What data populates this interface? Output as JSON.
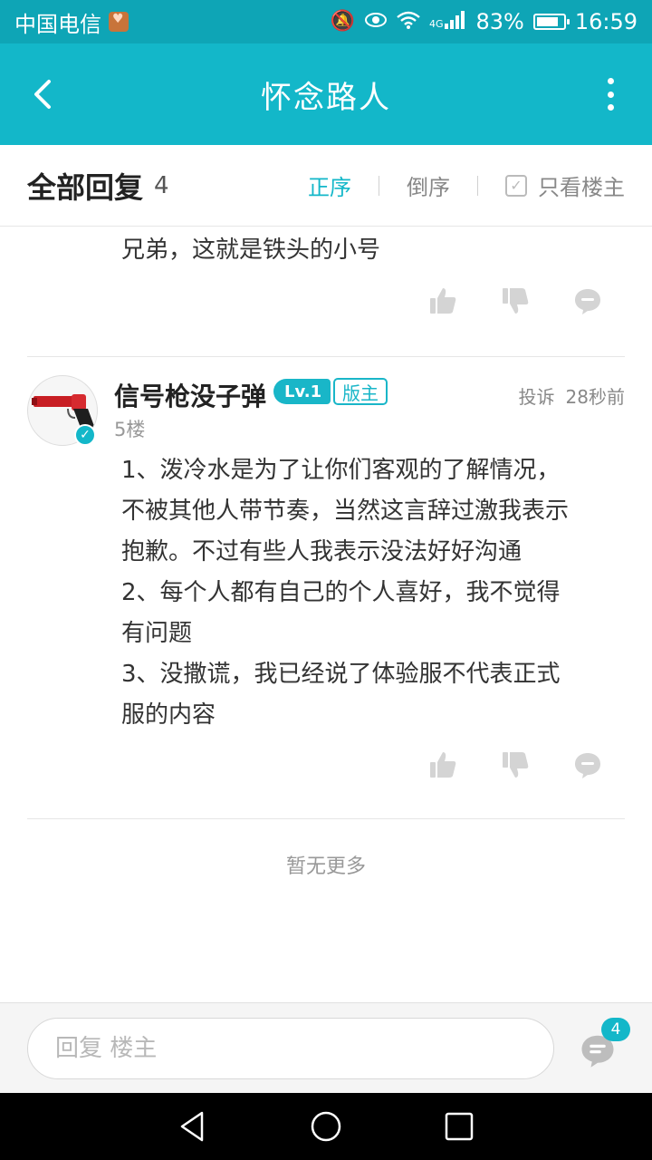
{
  "status_bar": {
    "carrier": "中国电信",
    "network": "4G",
    "battery": "83%",
    "battery_level": 0.83,
    "time": "16:59"
  },
  "app_bar": {
    "title": "怀念路人"
  },
  "sort_header": {
    "all_label": "全部回复",
    "count": "4",
    "order_asc": "正序",
    "order_desc": "倒序",
    "only_owner": "只看楼主"
  },
  "posts": [
    {
      "lines": [
        "兄弟，这就是铁头的小号"
      ]
    },
    {
      "author": "信号枪没子弹",
      "level": "Lv.1",
      "role": "版主",
      "floor": "5楼",
      "report": "投诉",
      "time": "28秒前",
      "lines": [
        "1、泼冷水是为了让你们客观的了解情况，",
        "不被其他人带节奏，当然这言辞过激我表示",
        "抱歉。不过有些人我表示没法好好沟通",
        "2、每个人都有自己的个人喜好，我不觉得",
        "有问题",
        "3、没撒谎，我已经说了体验服不代表正式",
        "服的内容"
      ]
    }
  ],
  "footer": {
    "no_more": "暂无更多"
  },
  "reply_bar": {
    "placeholder": "回复  楼主",
    "badge_count": "4"
  },
  "colors": {
    "accent": "#13b7c9",
    "status_bar": "#0ea5b6",
    "icon_gray": "#d4d4d4"
  }
}
